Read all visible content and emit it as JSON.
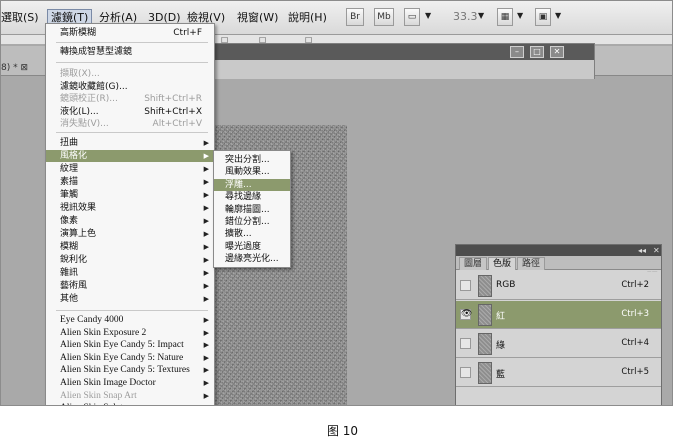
{
  "menubar": {
    "items": [
      {
        "label": "選取(S)"
      },
      {
        "label": "濾鏡(T)"
      },
      {
        "label": "分析(A)"
      },
      {
        "label": "3D(D)"
      },
      {
        "label": "檢視(V)"
      },
      {
        "label": "視窗(W)"
      },
      {
        "label": "說明(H)"
      }
    ],
    "bridge_label": "Br",
    "minibridge_label": "Mb",
    "zoom": "33.3"
  },
  "tab": {
    "text": "8) * ⊠"
  },
  "filter_menu": {
    "last_filter": {
      "label": "高斯模糊",
      "shortcut": "Ctrl+F"
    },
    "smart_convert": "轉換成智慧型濾鏡",
    "group1": [
      {
        "label": "擷取(X)...",
        "shortcut": "",
        "disabled": true
      },
      {
        "label": "濾鏡收藏館(G)...",
        "shortcut": "",
        "disabled": false
      },
      {
        "label": "鏡頭校正(R)...",
        "shortcut": "Shift+Ctrl+R",
        "disabled": true
      },
      {
        "label": "液化(L)...",
        "shortcut": "Shift+Ctrl+X",
        "disabled": false
      },
      {
        "label": "消失點(V)...",
        "shortcut": "Alt+Ctrl+V",
        "disabled": true
      }
    ],
    "group2": [
      {
        "label": "扭曲"
      },
      {
        "label": "風格化"
      },
      {
        "label": "紋理"
      },
      {
        "label": "素描"
      },
      {
        "label": "筆觸"
      },
      {
        "label": "視訊效果"
      },
      {
        "label": "像素"
      },
      {
        "label": "演算上色"
      },
      {
        "label": "模糊"
      },
      {
        "label": "銳利化"
      },
      {
        "label": "雜訊"
      },
      {
        "label": "藝術風"
      },
      {
        "label": "其他"
      }
    ],
    "group3": [
      {
        "label": "Eye Candy 4000",
        "disabled": false
      },
      {
        "label": "Alien Skin Exposure 2",
        "disabled": false
      },
      {
        "label": "Alien Skin Eye Candy 5: Impact",
        "disabled": false
      },
      {
        "label": "Alien Skin Eye Candy 5: Nature",
        "disabled": false
      },
      {
        "label": "Alien Skin Eye Candy 5: Textures",
        "disabled": false
      },
      {
        "label": "Alien Skin Image Doctor",
        "disabled": false
      },
      {
        "label": "Alien Skin Snap Art",
        "disabled": true
      },
      {
        "label": "Alien Skin Splat",
        "disabled": false
      }
    ]
  },
  "stylize_submenu": {
    "items": [
      {
        "label": "突出分割..."
      },
      {
        "label": "風動效果..."
      },
      {
        "label": "浮雕..."
      },
      {
        "label": "尋找邊緣"
      },
      {
        "label": "輪廓描圖..."
      },
      {
        "label": "錯位分割..."
      },
      {
        "label": "擴散..."
      },
      {
        "label": "曝光過度"
      },
      {
        "label": "邊緣亮光化..."
      }
    ]
  },
  "channels_panel": {
    "tabs": [
      {
        "label": "圖層"
      },
      {
        "label": "色版"
      },
      {
        "label": "路徑"
      }
    ],
    "collapse": "◂◂",
    "close": "✕",
    "channels": [
      {
        "name": "RGB",
        "shortcut": "Ctrl+2",
        "eye": ""
      },
      {
        "name": "紅",
        "shortcut": "Ctrl+3",
        "eye": "👁"
      },
      {
        "name": "綠",
        "shortcut": "Ctrl+4",
        "eye": ""
      },
      {
        "name": "藍",
        "shortcut": "Ctrl+5",
        "eye": ""
      }
    ]
  },
  "caption": "图 10",
  "colors": {
    "highlight": "#8c9a6d",
    "menu_bg": "#f7f7f7",
    "workspace": "#a9a9a9"
  }
}
